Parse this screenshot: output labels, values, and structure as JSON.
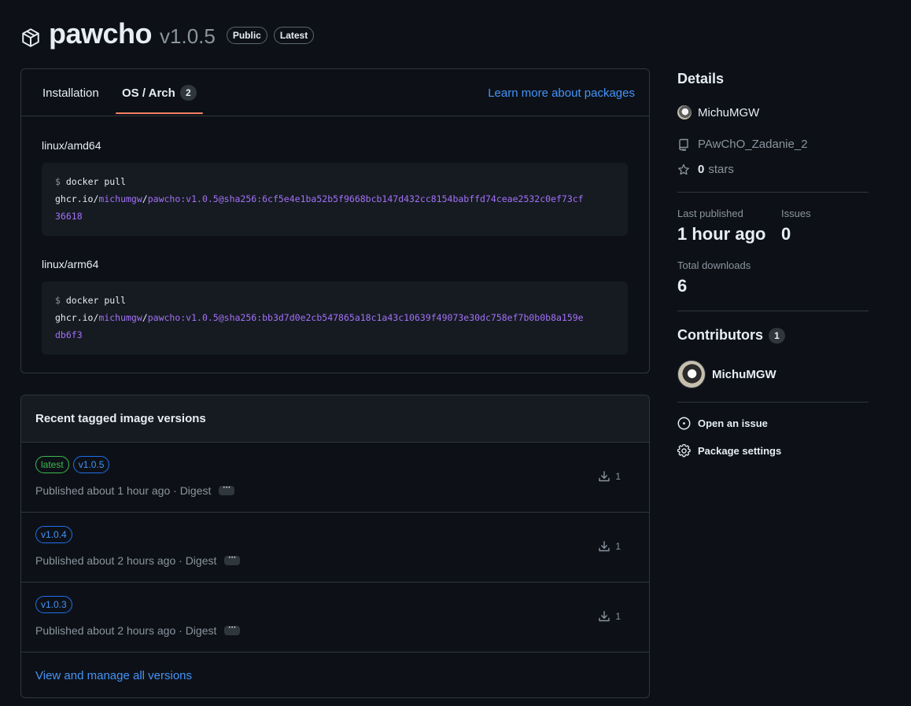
{
  "header": {
    "name": "pawcho",
    "version": "v1.0.5",
    "labels": [
      "Public",
      "Latest"
    ]
  },
  "tabs": [
    {
      "label": "Installation"
    },
    {
      "label": "OS / Arch",
      "count": "2"
    }
  ],
  "learn_more": "Learn more about packages",
  "architectures": [
    {
      "name": "linux/amd64",
      "prompt": "$",
      "command": "docker pull",
      "registry": "ghcr.io/",
      "owner": "michumgw",
      "sep": "/",
      "image_line1": "pawcho:v1.0.5@sha256:6cf5e4e1ba52b5f9668bcb147d432cc8154babffd74ceae2532c0ef73cf",
      "image_line2": "36618"
    },
    {
      "name": "linux/arm64",
      "prompt": "$",
      "command": "docker pull",
      "registry": "ghcr.io/",
      "owner": "michumgw",
      "sep": "/",
      "image_line1": "pawcho:v1.0.5@sha256:bb3d7d0e2cb547865a18c1a43c10639f49073e30dc758ef7b0b0b8a159e",
      "image_line2": "db6f3"
    }
  ],
  "versions": {
    "title": "Recent tagged image versions",
    "rows": [
      {
        "tags": [
          "latest",
          "v1.0.5"
        ],
        "published": "Published about 1 hour ago · Digest",
        "dots": "···",
        "downloads": "1"
      },
      {
        "tags": [
          "v1.0.4"
        ],
        "published": "Published about 2 hours ago · Digest",
        "dots": "···",
        "downloads": "1"
      },
      {
        "tags": [
          "v1.0.3"
        ],
        "published": "Published about 2 hours ago · Digest",
        "dots": "···",
        "downloads": "1"
      }
    ],
    "view_all": "View and manage all versions"
  },
  "sidebar": {
    "details_title": "Details",
    "owner": "MichuMGW",
    "repo": "PAwChO_Zadanie_2",
    "stars_count": "0",
    "stars_label": "stars",
    "last_published_label": "Last published",
    "last_published_value": "1 hour ago",
    "issues_label": "Issues",
    "issues_value": "0",
    "total_downloads_label": "Total downloads",
    "total_downloads_value": "6",
    "contributors_title": "Contributors",
    "contributors_count": "1",
    "contributor_name": "MichuMGW",
    "open_issue": "Open an issue",
    "package_settings": "Package settings"
  }
}
